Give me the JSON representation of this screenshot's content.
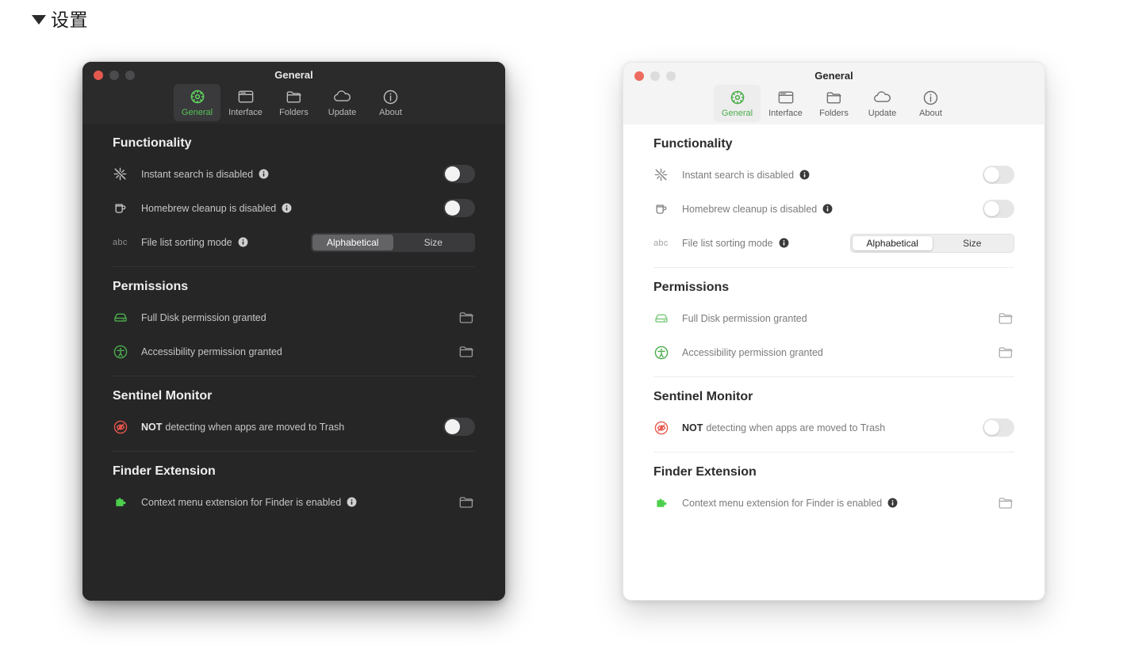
{
  "page": {
    "disclosure_icon": "triangle-down-icon",
    "title": "设置"
  },
  "window_title": "General",
  "tabs": [
    {
      "label": "General",
      "icon": "gear-icon",
      "selected": true
    },
    {
      "label": "Interface",
      "icon": "window-icon",
      "selected": false
    },
    {
      "label": "Folders",
      "icon": "folder-icon",
      "selected": false
    },
    {
      "label": "Update",
      "icon": "cloud-icon",
      "selected": false
    },
    {
      "label": "About",
      "icon": "info-circle-icon",
      "selected": false
    }
  ],
  "sections": {
    "functionality": {
      "title": "Functionality",
      "rows": {
        "instant_search": {
          "icon": "sparkle-slash-icon",
          "label": "Instant search is disabled",
          "info_icon": "info-icon",
          "control": "toggle",
          "toggle_state": "off"
        },
        "homebrew": {
          "icon": "mug-icon",
          "label": "Homebrew cleanup is disabled",
          "info_icon": "info-icon",
          "control": "toggle",
          "toggle_state": "off"
        },
        "sorting": {
          "icon": "abc-icon",
          "icon_text": "abc",
          "label": "File list sorting mode",
          "info_icon": "info-icon",
          "control": "segmented",
          "options": [
            "Alphabetical",
            "Size"
          ],
          "selected_option": "Alphabetical"
        }
      }
    },
    "permissions": {
      "title": "Permissions",
      "rows": {
        "full_disk": {
          "icon": "hard-drive-icon",
          "label": "Full Disk permission granted",
          "control": "folder-button"
        },
        "accessibility": {
          "icon": "accessibility-icon",
          "label": "Accessibility permission granted",
          "control": "folder-button"
        }
      }
    },
    "sentinel": {
      "title": "Sentinel Monitor",
      "rows": {
        "trash_monitor": {
          "icon": "eye-slash-circle-icon",
          "label_strong": "NOT",
          "label_rest": "detecting when apps are moved to Trash",
          "control": "toggle",
          "toggle_state": "off"
        }
      }
    },
    "finder": {
      "title": "Finder Extension",
      "rows": {
        "context_menu": {
          "icon": "puzzle-piece-icon",
          "label": "Context menu extension for Finder is enabled",
          "info_icon": "info-icon",
          "control": "folder-button"
        }
      }
    }
  },
  "colors": {
    "accent_green": "#4cd04c",
    "danger_red": "#e8564c",
    "dark_window_bg": "#262627",
    "light_window_bg": "#ffffff",
    "traffic_close": "#ec6a5e"
  }
}
